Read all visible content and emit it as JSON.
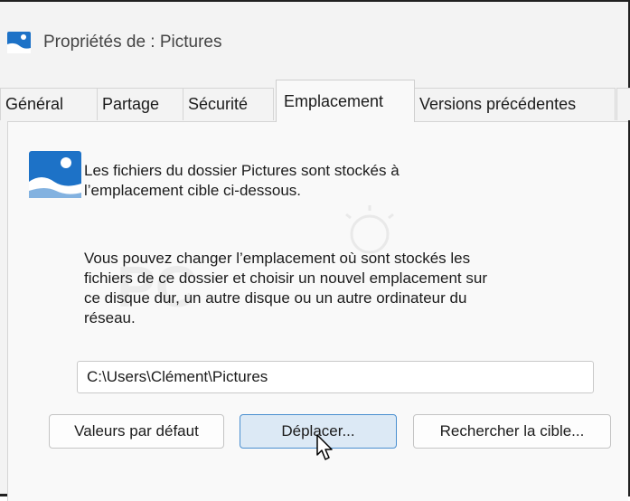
{
  "window": {
    "title": "Propriétés de : Pictures",
    "title_icon": "pictures-folder-icon"
  },
  "tabs": [
    {
      "label": "Général",
      "active": false
    },
    {
      "label": "Partage",
      "active": false
    },
    {
      "label": "Sécurité",
      "active": false
    },
    {
      "label": "Emplacement",
      "active": true
    },
    {
      "label": "Versions précédentes",
      "active": false
    }
  ],
  "panel": {
    "icon": "pictures-folder-icon",
    "intro_lines": [
      "Les fichiers du dossier Pictures sont stockés à",
      "l’emplacement cible ci-dessous."
    ],
    "info_lines": [
      "Vous pouvez changer l’emplacement où sont stockés les",
      "fichiers de ce dossier et choisir un nouvel emplacement sur",
      "ce disque dur, un autre disque ou un autre ordinateur du",
      "réseau."
    ],
    "path_value": "C:\\Users\\Clément\\Pictures",
    "buttons": {
      "default_label": "Valeurs par défaut",
      "move_label": "Déplacer...",
      "find_target_label": "Rechercher la cible..."
    }
  },
  "colors": {
    "accent": "#1d72c7",
    "button_highlight": "#dce9f5",
    "background": "#f3f3f3"
  }
}
